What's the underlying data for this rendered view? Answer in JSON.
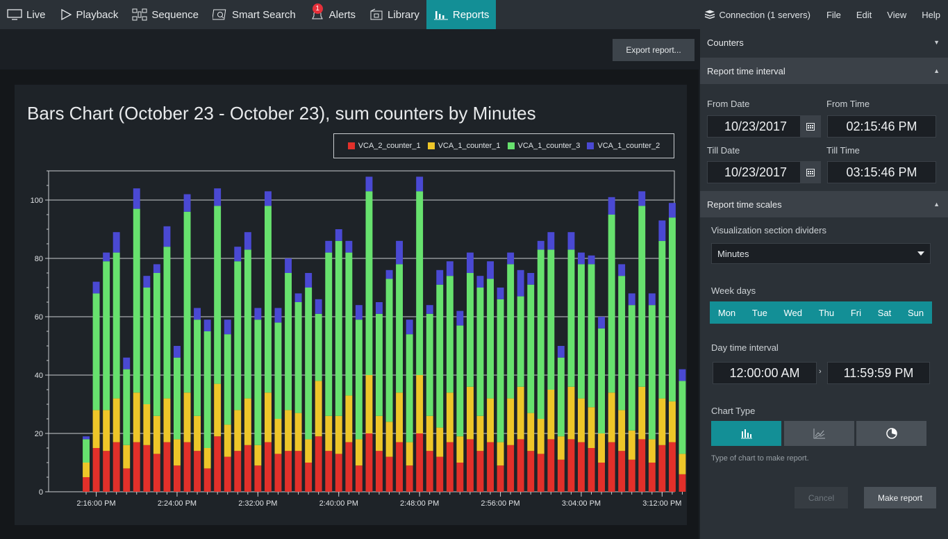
{
  "nav": {
    "items": [
      {
        "label": "Live",
        "icon": "monitor-icon"
      },
      {
        "label": "Playback",
        "icon": "play-icon"
      },
      {
        "label": "Sequence",
        "icon": "sequence-grid-icon"
      },
      {
        "label": "Smart Search",
        "icon": "smart-search-icon"
      },
      {
        "label": "Alerts",
        "icon": "bell-icon",
        "badge": "1"
      },
      {
        "label": "Library",
        "icon": "library-icon"
      },
      {
        "label": "Reports",
        "icon": "bar-chart-icon",
        "active": true
      }
    ],
    "connection": "Connection (1 servers)",
    "menus": [
      "File",
      "Edit",
      "View",
      "Help"
    ]
  },
  "toolbar": {
    "export_label": "Export report..."
  },
  "colors": {
    "accent": "#138f96",
    "alert": "#e5303a"
  },
  "chart_data": {
    "type": "bar",
    "stacked": true,
    "title": "Bars Chart (October 23 - October 23), sum counters by Minutes",
    "legend_position": "top-right",
    "grid": true,
    "ylim": [
      0,
      110
    ],
    "y_ticks": [
      0,
      20,
      40,
      60,
      80,
      100
    ],
    "x_tick_labels": [
      "2:16:00 PM",
      "2:24:00 PM",
      "2:32:00 PM",
      "2:40:00 PM",
      "2:48:00 PM",
      "2:56:00 PM",
      "3:04:00 PM",
      "3:12:00 PM"
    ],
    "x_tick_every": 8,
    "x_tick_start_index": 1,
    "series": [
      {
        "name": "VCA_2_counter_1",
        "color": "#e2302a",
        "values": [
          5,
          15,
          14,
          17,
          8,
          17,
          16,
          13,
          17,
          9,
          17,
          14,
          8,
          19,
          12,
          14,
          16,
          9,
          17,
          13,
          14,
          14,
          10,
          19,
          14,
          13,
          17,
          9,
          20,
          14,
          12,
          17,
          9,
          20,
          14,
          12,
          17,
          10,
          18,
          14,
          17,
          9,
          16,
          18,
          14,
          13,
          18,
          11,
          18,
          17,
          15,
          10,
          17,
          14,
          11,
          18,
          10,
          16,
          17,
          6
        ]
      },
      {
        "name": "VCA_1_counter_1",
        "color": "#eec629",
        "values": [
          5,
          13,
          14,
          15,
          8,
          17,
          14,
          13,
          15,
          9,
          17,
          12,
          7,
          18,
          11,
          14,
          16,
          7,
          17,
          12,
          14,
          13,
          8,
          19,
          12,
          13,
          16,
          9,
          20,
          12,
          12,
          17,
          8,
          20,
          12,
          10,
          17,
          9,
          18,
          12,
          15,
          8,
          16,
          18,
          13,
          12,
          17,
          8,
          18,
          15,
          14,
          10,
          17,
          14,
          10,
          18,
          8,
          16,
          14,
          7
        ]
      },
      {
        "name": "VCA_1_counter_3",
        "color": "#67e16e",
        "values": [
          8,
          40,
          51,
          50,
          26,
          63,
          40,
          49,
          52,
          28,
          62,
          33,
          40,
          61,
          31,
          51,
          51,
          43,
          64,
          33,
          47,
          38,
          52,
          23,
          56,
          60,
          49,
          41,
          63,
          35,
          49,
          44,
          37,
          63,
          35,
          49,
          40,
          38,
          39,
          44,
          41,
          49,
          46,
          31,
          44,
          58,
          48,
          27,
          47,
          46,
          49,
          36,
          61,
          46,
          43,
          62,
          46,
          54,
          63,
          25
        ]
      },
      {
        "name": "VCA_1_counter_2",
        "color": "#4a49d3",
        "values": [
          1,
          4,
          3,
          7,
          4,
          7,
          4,
          3,
          7,
          4,
          6,
          4,
          4,
          6,
          5,
          5,
          6,
          4,
          5,
          5,
          5,
          3,
          5,
          5,
          4,
          4,
          4,
          5,
          5,
          4,
          3,
          8,
          5,
          5,
          3,
          5,
          5,
          5,
          7,
          4,
          6,
          4,
          4,
          9,
          4,
          3,
          6,
          4,
          6,
          4,
          3,
          4,
          6,
          4,
          4,
          5,
          4,
          7,
          5,
          4
        ]
      }
    ]
  },
  "sidebar": {
    "counters_label": "Counters",
    "interval_label": "Report time interval",
    "from_date_label": "From Date",
    "from_time_label": "From Time",
    "from_date": "10/23/2017",
    "from_time": "02:15:46 PM",
    "till_date_label": "Till Date",
    "till_time_label": "Till Time",
    "till_date": "10/23/2017",
    "till_time": "03:15:46 PM",
    "scales_label": "Report time scales",
    "viz_label": "Visualization section dividers",
    "viz_value": "Minutes",
    "weekdays_label": "Week days",
    "weekdays": [
      "Mon",
      "Tue",
      "Wed",
      "Thu",
      "Fri",
      "Sat",
      "Sun"
    ],
    "daytime_label": "Day time interval",
    "day_start": "12:00:00 AM",
    "day_end": "11:59:59 PM",
    "chart_type_label": "Chart Type",
    "chart_type_hint": "Type of chart to make report.",
    "cancel_label": "Cancel",
    "make_label": "Make report"
  }
}
